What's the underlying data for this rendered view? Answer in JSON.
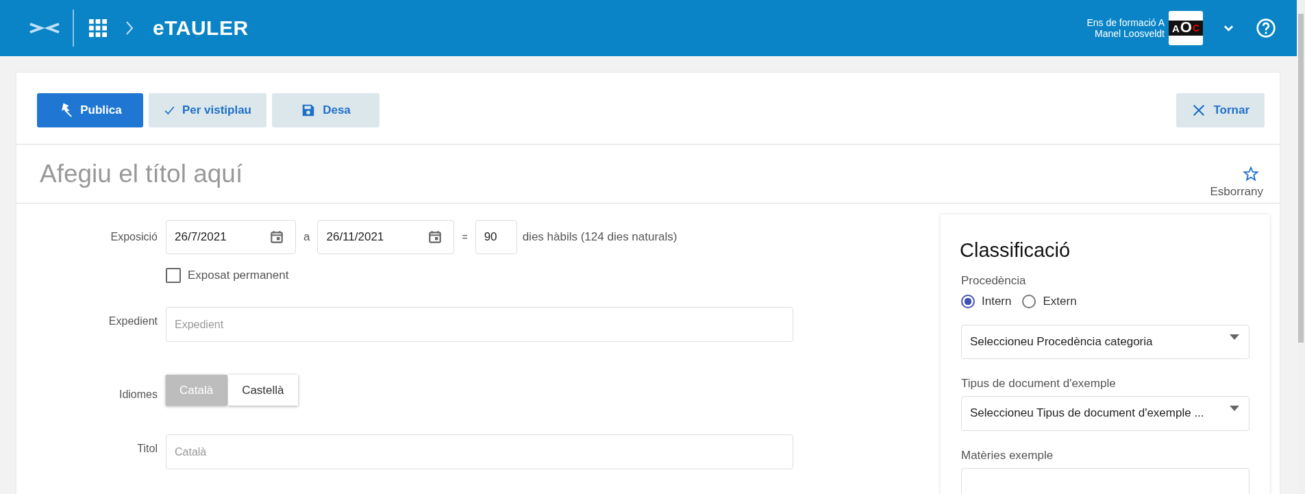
{
  "header": {
    "app_name": "eTAULER",
    "org": "Ens de formació A",
    "user": "Manel Loosveldt",
    "logo_letters": [
      "A",
      "O",
      "C"
    ]
  },
  "toolbar": {
    "buttons": [
      {
        "label": "Publica",
        "kind": "primary"
      },
      {
        "label": "Per vistiplau",
        "kind": "check"
      },
      {
        "label": "Desa",
        "kind": "save"
      }
    ],
    "back": "Tornar"
  },
  "title": {
    "placeholder": "Afegiu el títol aquí",
    "status": "Esborrany",
    "starred": false
  },
  "form": {
    "exposure": {
      "label": "Exposició",
      "from": "26/7/2021",
      "sep": "a",
      "to": "26/11/2021",
      "eq": "=",
      "days": "90",
      "days_text": "dies hàbils (124 dies naturals)"
    },
    "permanent": {
      "label": "Exposat permanent",
      "checked": false
    },
    "expedient": {
      "label": "Expedient",
      "placeholder": "Expedient"
    },
    "languages": {
      "label": "Idiomes",
      "items": [
        {
          "label": "Català",
          "selected": true
        },
        {
          "label": "Castellà",
          "selected": false
        }
      ]
    },
    "title_field": {
      "label": "Titol",
      "placeholder": "Català"
    }
  },
  "classification": {
    "heading": "Classificació",
    "origin_label": "Procedència",
    "origin_options": [
      {
        "label": "Intern",
        "selected": true
      },
      {
        "label": "Extern",
        "selected": false
      }
    ],
    "origin_select": "Seleccioneu Procedència categoria",
    "doc_type_label": "Tipus de document d'exemple",
    "doc_type_select": "Seleccioneu Tipus de document d'exemple ...",
    "subjects_label": "Matèries exemple"
  }
}
